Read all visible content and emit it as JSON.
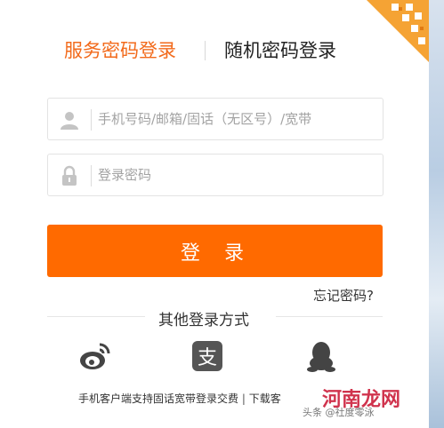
{
  "tabs": {
    "service_password": "服务密码登录",
    "random_password": "随机密码登录"
  },
  "form": {
    "account_placeholder": "手机号码/邮箱/固话（无区号）/宽带",
    "password_placeholder": "登录密码",
    "login_label": "登 录",
    "forgot_label": "忘记密码?"
  },
  "other_login": {
    "title": "其他登录方式",
    "providers": [
      "weibo-icon",
      "alipay-icon",
      "qq-icon"
    ]
  },
  "footer": {
    "text": "手机客户端支持固话宽带登录交费",
    "separator": "|",
    "download": "下载客"
  },
  "watermark": {
    "main": "河南龙网",
    "sub": "头条 @社度零泳"
  },
  "colors": {
    "accent": "#ff6a00",
    "tab_active": "#f26a1b"
  }
}
